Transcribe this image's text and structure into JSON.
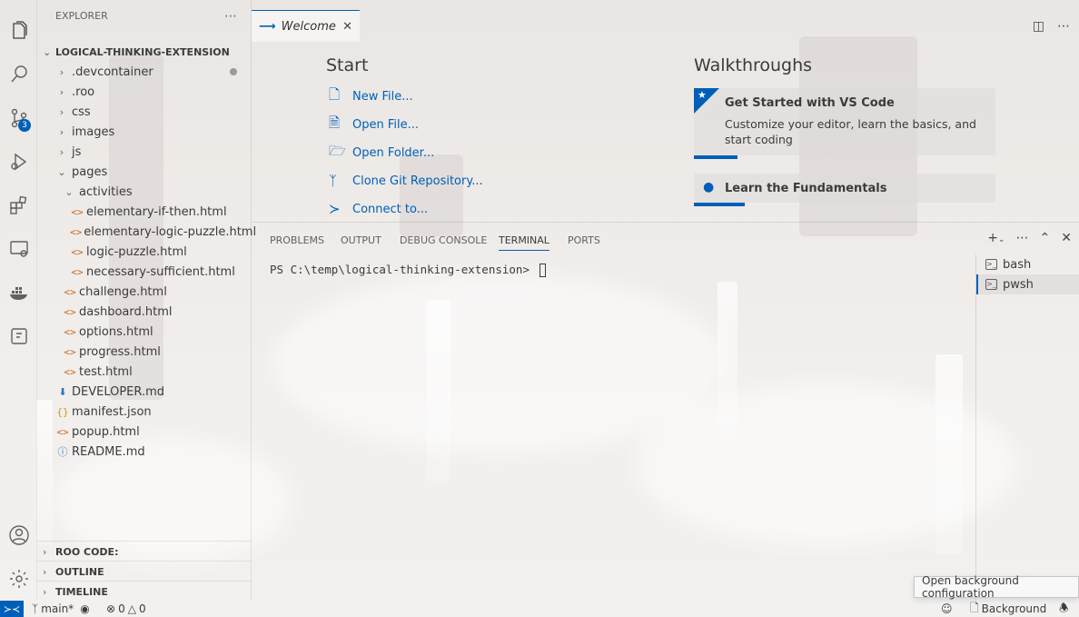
{
  "activity_bar": {
    "scm_badge": "3"
  },
  "sidebar": {
    "title": "EXPLORER",
    "more": "⋯",
    "root": "LOGICAL-THINKING-EXTENSION",
    "items": [
      {
        "label": ".devcontainer",
        "kind": "folder",
        "twist": "›",
        "indent": 1
      },
      {
        "label": ".roo",
        "kind": "folder",
        "twist": "›",
        "indent": 1
      },
      {
        "label": "css",
        "kind": "folder",
        "twist": "›",
        "indent": 1
      },
      {
        "label": "images",
        "kind": "folder",
        "twist": "›",
        "indent": 1
      },
      {
        "label": "js",
        "kind": "folder",
        "twist": "›",
        "indent": 1
      },
      {
        "label": "pages",
        "kind": "folder-open",
        "twist": "⌄",
        "indent": 1
      },
      {
        "label": "activities",
        "kind": "folder-open",
        "twist": "⌄",
        "indent": 2
      },
      {
        "label": "elementary-if-then.html",
        "kind": "html",
        "indent": 3
      },
      {
        "label": "elementary-logic-puzzle.html",
        "kind": "html",
        "indent": 3
      },
      {
        "label": "logic-puzzle.html",
        "kind": "html",
        "indent": 3
      },
      {
        "label": "necessary-sufficient.html",
        "kind": "html",
        "indent": 3
      },
      {
        "label": "challenge.html",
        "kind": "html",
        "indent": 2
      },
      {
        "label": "dashboard.html",
        "kind": "html",
        "indent": 2
      },
      {
        "label": "options.html",
        "kind": "html",
        "indent": 2
      },
      {
        "label": "progress.html",
        "kind": "html",
        "indent": 2
      },
      {
        "label": "test.html",
        "kind": "html",
        "indent": 2
      },
      {
        "label": "DEVELOPER.md",
        "kind": "md",
        "indent": 1
      },
      {
        "label": "manifest.json",
        "kind": "json",
        "indent": 1
      },
      {
        "label": "popup.html",
        "kind": "html",
        "indent": 1
      },
      {
        "label": "README.md",
        "kind": "info",
        "indent": 1
      }
    ],
    "sections": [
      "ROO CODE:",
      "OUTLINE",
      "TIMELINE"
    ]
  },
  "icons": {
    "html": "<>",
    "json": "{}",
    "md": "⬇",
    "info": "ⓘ"
  },
  "tabs": [
    {
      "label": "Welcome",
      "close": "✕"
    }
  ],
  "welcome": {
    "start_title": "Start",
    "start_links": [
      "New File...",
      "Open File...",
      "Open Folder...",
      "Clone Git Repository...",
      "Connect to..."
    ],
    "walkthroughs_title": "Walkthroughs",
    "cards": [
      {
        "title": "Get Started with VS Code",
        "desc": "Customize your editor, learn the basics, and start coding"
      },
      {
        "title": "Learn the Fundamentals",
        "desc": ""
      }
    ]
  },
  "panel": {
    "tabs": [
      "PROBLEMS",
      "OUTPUT",
      "DEBUG CONSOLE",
      "TERMINAL",
      "PORTS"
    ],
    "active_tab": "TERMINAL",
    "prompt": "PS C:\\temp\\logical-thinking-extension> ",
    "terminals": [
      "bash",
      "pwsh"
    ],
    "active_terminal": "pwsh"
  },
  "status_bar": {
    "branch": "main*",
    "errors": "0",
    "warnings": "0",
    "background_label": "Background"
  },
  "tooltip": "Open background configuration",
  "colors": {
    "accent": "#005fb8",
    "html_icon": "#c8691d",
    "json_icon": "#c8a21d",
    "md_icon": "#2e6fc5"
  }
}
